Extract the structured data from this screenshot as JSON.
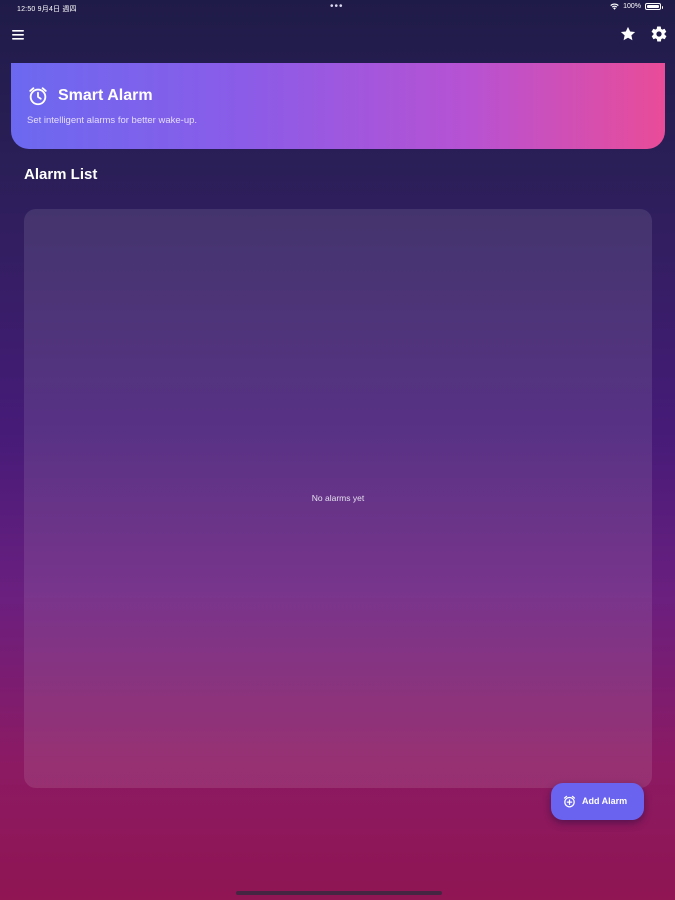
{
  "status_bar": {
    "time_date": "12:50  9月4日 週四",
    "center_dots": "•••",
    "battery_text": "100%",
    "battery_level": 1.0
  },
  "app_bar": {
    "menu_icon": "hamburger-menu-icon",
    "favorite_icon": "star-icon",
    "settings_icon": "gear-icon"
  },
  "header": {
    "icon": "alarm-clock-icon",
    "title": "Smart Alarm",
    "subtitle": "Set intelligent alarms for better wake-up."
  },
  "alarm_list": {
    "title": "Alarm List",
    "empty_message": "No alarms yet"
  },
  "fab": {
    "icon": "add-alarm-icon",
    "label": "Add Alarm"
  },
  "colors": {
    "background_top": "#1f1b48",
    "background_middle": "#461b78",
    "background_bottom": "#8f1553",
    "header_gradient_start": "#6c69f0",
    "header_gradient_end": "#e94c98",
    "fab_background": "#6a63f0"
  }
}
